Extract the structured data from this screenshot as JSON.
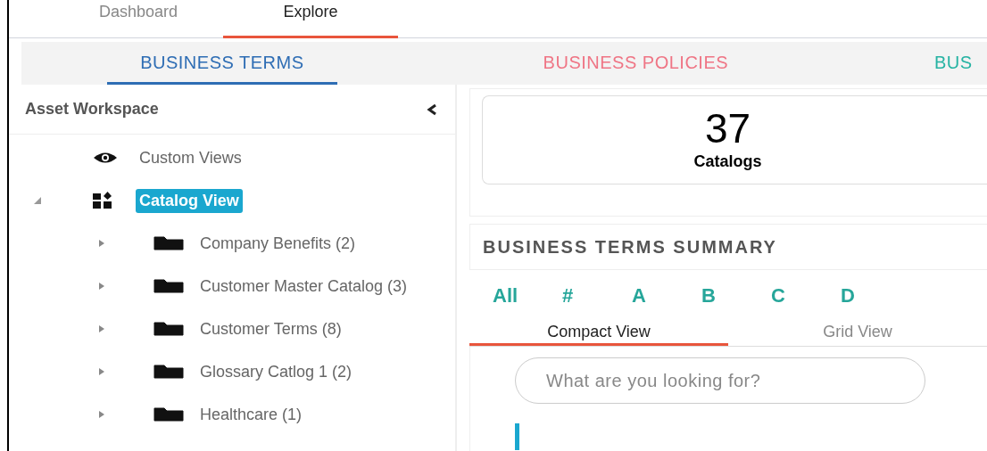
{
  "top_tabs": [
    {
      "label": "Dashboard",
      "selected": false
    },
    {
      "label": "Explore",
      "selected": true
    }
  ],
  "sub_tabs": [
    {
      "label": "BUSINESS TERMS",
      "selected": true,
      "color": "#2e6db4"
    },
    {
      "label": "BUSINESS POLICIES",
      "selected": false,
      "color": "#ef7585"
    },
    {
      "label": "BUS",
      "selected": false,
      "color": "#26b3a3"
    }
  ],
  "sidebar": {
    "title": "Asset Workspace",
    "items": [
      {
        "label": "Custom Views",
        "kind": "views",
        "selected": false
      },
      {
        "label": "Catalog View",
        "kind": "catalog",
        "selected": true,
        "expanded": true,
        "children": [
          {
            "label": "Company Benefits (2)",
            "kind": "folder",
            "selected": false,
            "expanded": false
          },
          {
            "label": "Customer Master Catalog (3)",
            "kind": "folder",
            "selected": false,
            "expanded": false
          },
          {
            "label": "Customer Terms (8)",
            "kind": "folder",
            "selected": false,
            "expanded": false
          },
          {
            "label": "Glossary Catlog 1 (2)",
            "kind": "folder",
            "selected": false,
            "expanded": false
          },
          {
            "label": "Healthcare (1)",
            "kind": "folder",
            "selected": false,
            "expanded": false
          }
        ]
      }
    ]
  },
  "stat": {
    "value": "37",
    "label": "Catalogs"
  },
  "summary": {
    "title": "BUSINESS TERMS SUMMARY",
    "letters": [
      "All",
      "#",
      "A",
      "B",
      "C",
      "D"
    ],
    "view_tabs": [
      {
        "label": "Compact View",
        "selected": true
      },
      {
        "label": "Grid View",
        "selected": false
      }
    ],
    "search": {
      "placeholder": "What are you looking for?"
    }
  }
}
